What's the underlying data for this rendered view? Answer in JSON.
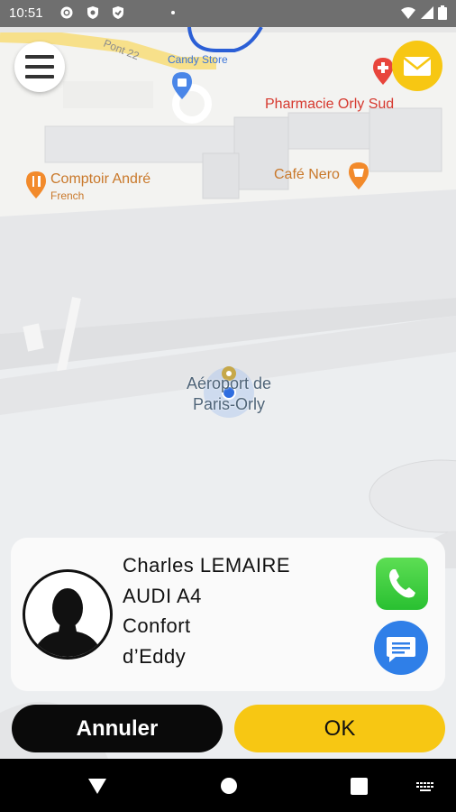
{
  "status_bar": {
    "time": "10:51",
    "left_icons": [
      "gear-icon",
      "shield-icon",
      "shield-icon",
      "dot-icon"
    ],
    "right_icons": [
      "wifi-icon",
      "signal-icon",
      "battery-icon"
    ]
  },
  "map": {
    "road_label": "Pont 22",
    "pois": {
      "candy_store": "Candy Store",
      "pharmacie": "Pharmacie Orly Sud",
      "comptoir": "Comptoir André",
      "comptoir_sub": "French",
      "cafe": "Café Nero"
    },
    "airport_line1": "Aéroport de",
    "airport_line2": "Paris-Orly"
  },
  "driver": {
    "name": "Charles LEMAIRE",
    "car": "AUDI A4",
    "category": "Confort",
    "company": "d’Eddy"
  },
  "buttons": {
    "cancel": "Annuler",
    "ok": "OK"
  },
  "colors": {
    "accent": "#f7c713",
    "dark_button": "#0a0a0a",
    "phone_green": "#34c83c",
    "message_blue": "#2f7fe8",
    "status_bar": "#6f6f6f"
  }
}
